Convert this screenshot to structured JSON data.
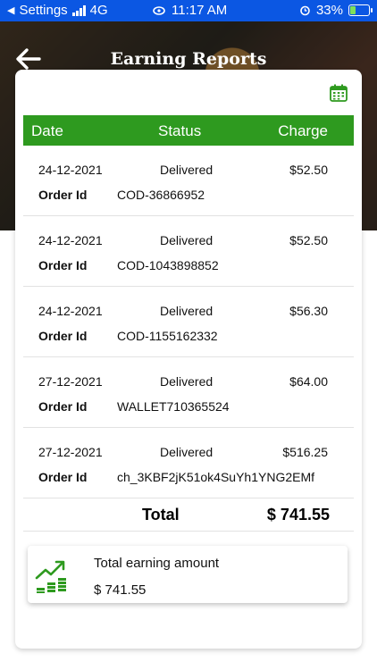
{
  "status_bar": {
    "back_to_app": "Settings",
    "network": "4G",
    "time": "11:17 AM",
    "battery": "33%",
    "battery_level": 0.33
  },
  "header": {
    "title": "Earning Reports"
  },
  "table": {
    "columns": [
      "Date",
      "Status",
      "Charge"
    ],
    "order_id_label": "Order Id",
    "rows": [
      {
        "date": "24-12-2021",
        "status": "Delivered",
        "charge": "$52.50",
        "order_id": "COD-36866952"
      },
      {
        "date": "24-12-2021",
        "status": "Delivered",
        "charge": "$52.50",
        "order_id": "COD-1043898852"
      },
      {
        "date": "24-12-2021",
        "status": "Delivered",
        "charge": "$56.30",
        "order_id": "COD-1155162332"
      },
      {
        "date": "27-12-2021",
        "status": "Delivered",
        "charge": "$64.00",
        "order_id": "WALLET710365524"
      },
      {
        "date": "27-12-2021",
        "status": "Delivered",
        "charge": "$516.25",
        "order_id": "ch_3KBF2jK51ok4SuYh1YNG2EMf"
      }
    ],
    "total_label": "Total",
    "total_value": "$ 741.55"
  },
  "summary": {
    "label": "Total earning amount",
    "value": "$ 741.55"
  },
  "colors": {
    "status_bar": "#0b57e3",
    "accent": "#2e9a1f"
  },
  "icons": {
    "back": "arrow-left-icon",
    "calendar": "calendar-icon",
    "earning": "chart-growth-icon"
  }
}
